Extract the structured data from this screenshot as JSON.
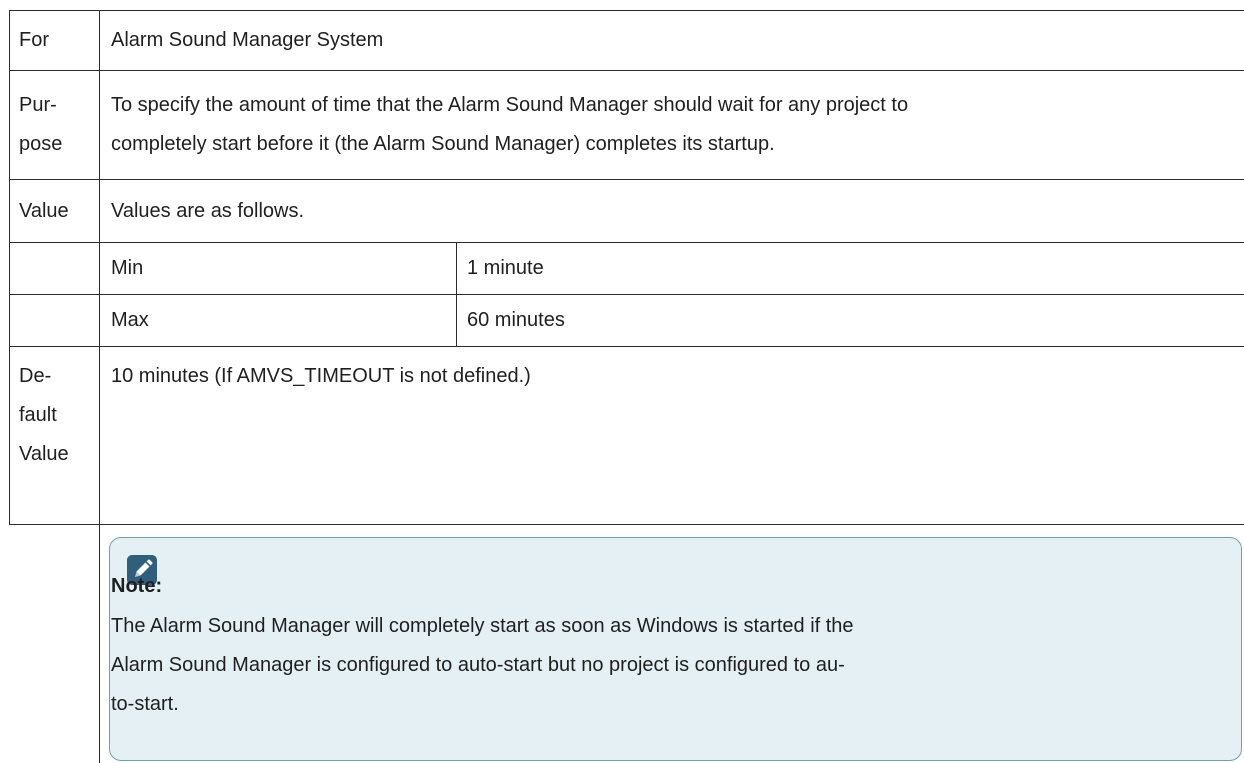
{
  "rows": {
    "for": {
      "label": "For",
      "value": "Alarm Sound Manager System"
    },
    "purpose": {
      "label_lines": [
        "Pur-",
        "pose"
      ],
      "value_lines": [
        "To specify the amount of time that  the Alarm Sound Manager should wait for any project to",
        "completely start before it (the Alarm Sound Manager) completes its startup."
      ]
    },
    "value": {
      "label": "Value",
      "text": "Values are as follows.",
      "min": {
        "label": "Min",
        "value": "1 minute"
      },
      "max": {
        "label": "Max",
        "value": "60 minutes"
      }
    },
    "default": {
      "label_lines": [
        "De-",
        "fault",
        "Value"
      ],
      "value": "10 minutes (If AMVS_TIMEOUT is not defined.)"
    }
  },
  "note": {
    "icon": "pencil-note-icon",
    "title": "Note:",
    "body_lines": [
      "The Alarm Sound Manager will completely start as soon as Windows is started if the",
      "Alarm Sound Manager is configured to auto-start but no project is configured to au-",
      "to-start."
    ],
    "colors": {
      "background": "#e5f0f4",
      "border": "#6f9fb3",
      "icon": "#2f5f7d"
    }
  }
}
